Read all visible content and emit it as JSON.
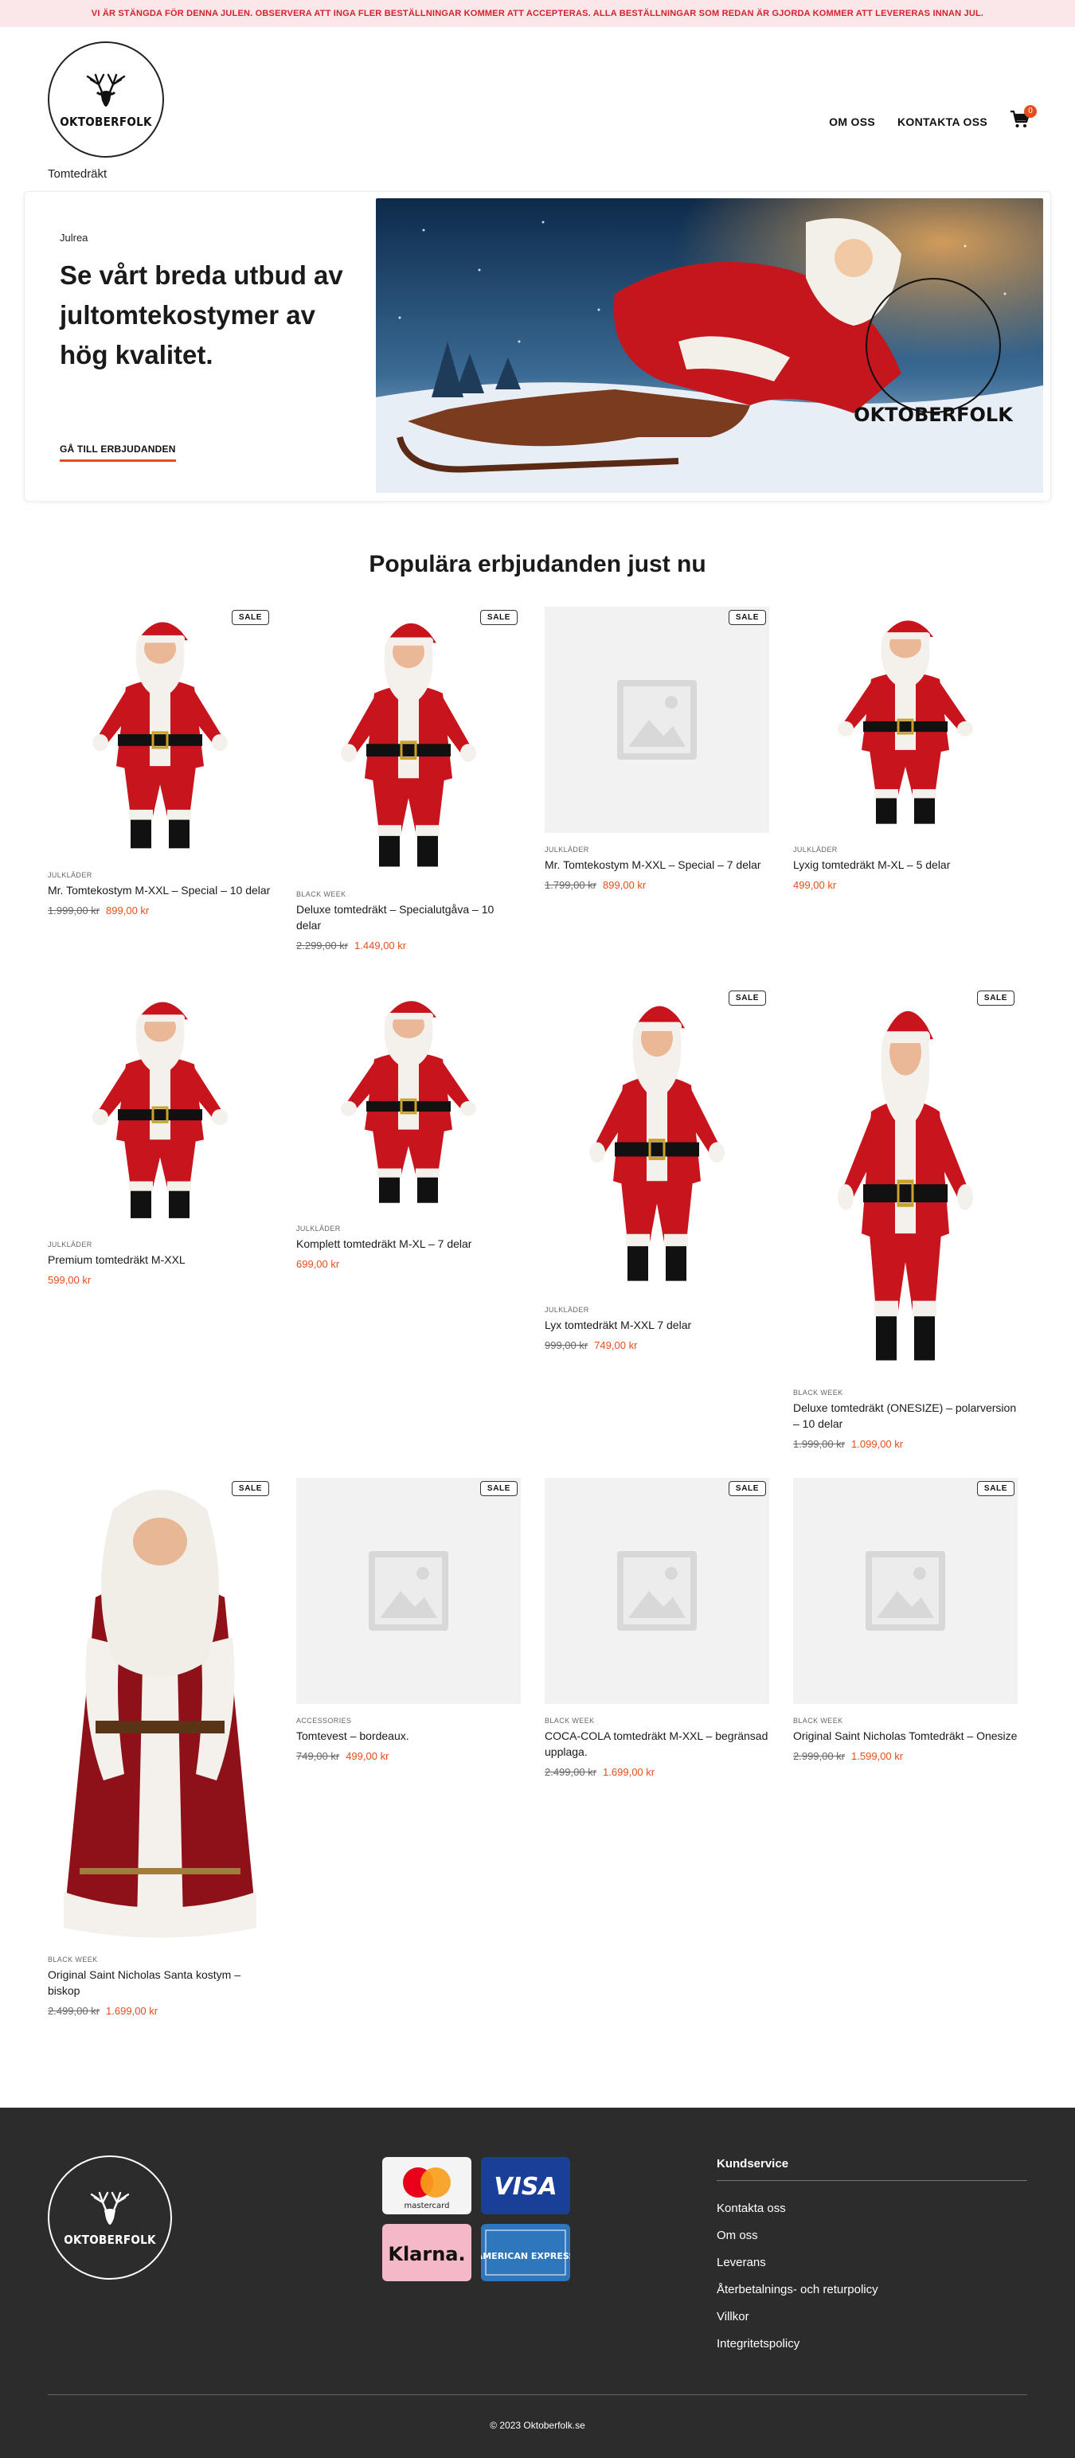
{
  "notice": {
    "text": "VI ÄR STÄNGDA FÖR DENNA JULEN. OBSERVERA ATT INGA FLER BESTÄLLNINGAR KOMMER ATT ACCEPTERAS. ALLA BESTÄLLNINGAR SOM REDAN ÄR GJORDA KOMMER ATT LEVERERAS INNAN JUL."
  },
  "header": {
    "logo_text": "OKTOBERFOLK",
    "site_title": "Tomtedräkt",
    "nav": [
      "OM OSS",
      "KONTAKTA OSS"
    ],
    "cart_count": "0"
  },
  "hero": {
    "eyebrow": "Julrea",
    "heading": "Se vårt breda utbud av jultomtekostymer av hög kvalitet.",
    "cta": "GÅ TILL ERBJUDANDEN",
    "image_logo_text": "OKTOBERFOLK"
  },
  "products_section": {
    "title": "Populära erbjudanden just nu"
  },
  "products": [
    {
      "category": "JULKLÄDER",
      "name": "Mr. Tomtekostym M-XXL – Special – 10 delar",
      "old_price": "1.999,00 kr",
      "price": "899,00 kr",
      "sale": "SALE",
      "image": "santa-suit-photo"
    },
    {
      "category": "BLACK WEEK",
      "name": "Deluxe tomtedräkt – Specialutgåva – 10 delar",
      "old_price": "2.299,00 kr",
      "price": "1.449,00 kr",
      "sale": "SALE",
      "image": "santa-suit-photo"
    },
    {
      "category": "JULKLÄDER",
      "name": "Mr. Tomtekostym M-XXL – Special – 7 delar",
      "old_price": "1.799,00 kr",
      "price": "899,00 kr",
      "sale": "SALE",
      "image": "placeholder"
    },
    {
      "category": "JULKLÄDER",
      "name": "Lyxig tomtedräkt M-XL – 5 delar",
      "old_price": "",
      "price": "499,00 kr",
      "sale": "",
      "image": "santa-suit-photo"
    },
    {
      "category": "JULKLÄDER",
      "name": "Premium tomtedräkt M-XXL",
      "old_price": "",
      "price": "599,00 kr",
      "sale": "",
      "image": "santa-suit-photo"
    },
    {
      "category": "JULKLÄDER",
      "name": "Komplett tomtedräkt M-XL – 7 delar",
      "old_price": "",
      "price": "699,00 kr",
      "sale": "",
      "image": "santa-suit-photo"
    },
    {
      "category": "JULKLÄDER",
      "name": "Lyx tomtedräkt M-XXL 7 delar",
      "old_price": "999,00 kr",
      "price": "749,00 kr",
      "sale": "SALE",
      "image": "santa-suit-photo"
    },
    {
      "category": "BLACK WEEK",
      "name": "Deluxe tomtedräkt (ONESIZE) – polarversion – 10 delar",
      "old_price": "1.999,00 kr",
      "price": "1.099,00 kr",
      "sale": "SALE",
      "image": "santa-suit-photo"
    },
    {
      "category": "BLACK WEEK",
      "name": "Original Saint Nicholas Santa kostym – biskop",
      "old_price": "2.499,00 kr",
      "price": "1.699,00 kr",
      "sale": "SALE",
      "image": "santa-robe-photo"
    },
    {
      "category": "ACCESSORIES",
      "name": "Tomtevest – bordeaux.",
      "old_price": "749,00 kr",
      "price": "499,00 kr",
      "sale": "SALE",
      "image": "placeholder"
    },
    {
      "category": "BLACK WEEK",
      "name": "COCA-COLA tomtedräkt M-XXL – begränsad upplaga.",
      "old_price": "2.499,00 kr",
      "price": "1.699,00 kr",
      "sale": "SALE",
      "image": "placeholder"
    },
    {
      "category": "BLACK WEEK",
      "name": "Original Saint Nicholas Tomtedräkt – Onesize",
      "old_price": "2.999,00 kr",
      "price": "1.599,00 kr",
      "sale": "SALE",
      "image": "placeholder"
    }
  ],
  "footer": {
    "logo_text": "OKTOBERFOLK",
    "payments": [
      "mastercard",
      "VISA",
      "Klarna.",
      "AMERICAN EXPRESS"
    ],
    "customer_service": {
      "title": "Kundservice",
      "links": [
        "Kontakta oss",
        "Om oss",
        "Leverans",
        "Återbetalnings- och returpolicy",
        "Villkor",
        "Integritetspolicy"
      ]
    },
    "copyright": "© 2023 Oktoberfolk.se"
  },
  "colors": {
    "accent": "#e84e1b",
    "notice_bg": "#fbe6ea",
    "notice_text": "#d4222d",
    "footer_bg": "#2c2c2c"
  }
}
